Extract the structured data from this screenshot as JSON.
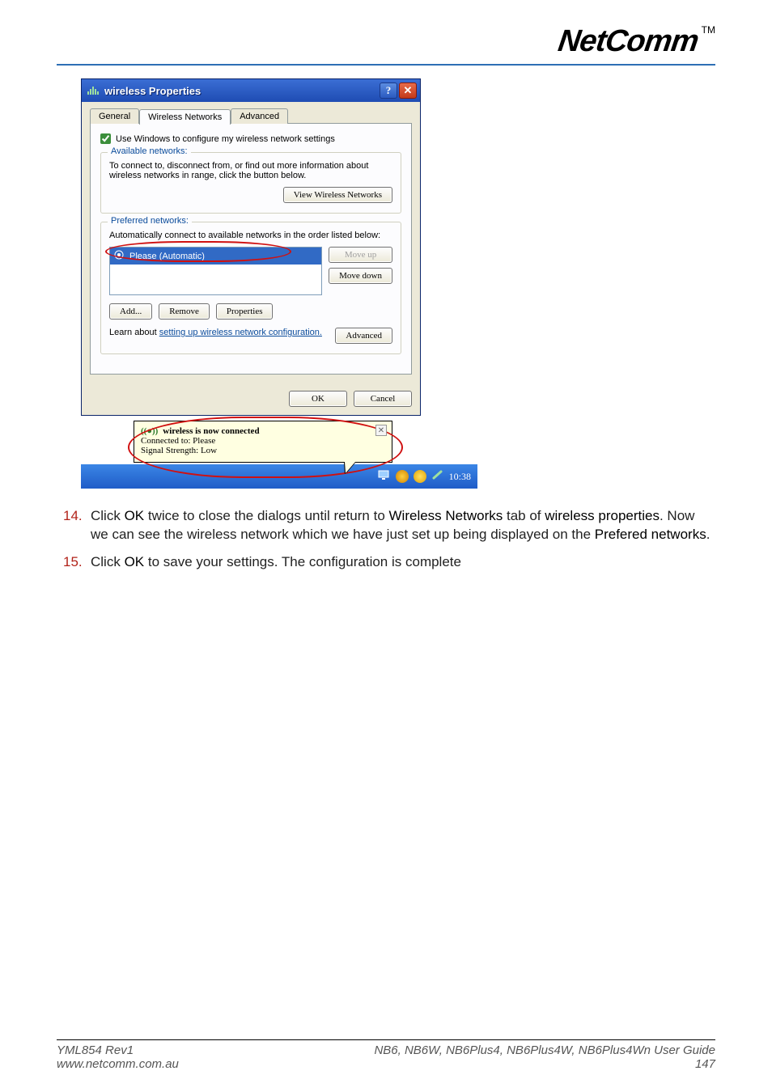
{
  "brand": {
    "name": "NetComm",
    "tm": "TM"
  },
  "dialog": {
    "title": "wireless Properties",
    "tabs": {
      "general": "General",
      "wireless": "Wireless Networks",
      "advanced": "Advanced"
    },
    "use_windows_label": "Use Windows to configure my wireless network settings",
    "available": {
      "legend": "Available networks:",
      "desc": "To connect to, disconnect from, or find out more information about wireless networks in range, click the button below.",
      "view_btn": "View Wireless Networks"
    },
    "preferred": {
      "legend": "Preferred networks:",
      "desc": "Automatically connect to available networks in the order listed below:",
      "item": "Please (Automatic)",
      "move_up": "Move up",
      "move_down": "Move down",
      "add": "Add...",
      "remove": "Remove",
      "properties": "Properties",
      "learn_prefix": "Learn about ",
      "learn_link": "setting up wireless network configuration.",
      "advanced_btn": "Advanced"
    },
    "ok": "OK",
    "cancel": "Cancel"
  },
  "balloon": {
    "title": "wireless is now connected",
    "line1": "Connected to: Please",
    "line2": "Signal Strength: Low"
  },
  "taskbar": {
    "clock": "10:38"
  },
  "steps": {
    "s14_num": "14.",
    "s14_a": "Click ",
    "s14_b": "OK",
    "s14_c": " twice to close the dialogs until return to ",
    "s14_d": "Wireless Networks",
    "s14_e": " tab of ",
    "s14_f": "wireless properties",
    "s14_g": ". Now we can see the wireless network which we have just set up being displayed on the ",
    "s14_h": "Prefered networks",
    "s14_i": ".",
    "s15_num": "15.",
    "s15_a": "Click ",
    "s15_b": "OK",
    "s15_c": " to save your settings. The configuration is complete"
  },
  "footer": {
    "left1": "YML854 Rev1",
    "left2": "www.netcomm.com.au",
    "right1_models": "NB6, NB6W, NB6Plus4, NB6Plus4W, NB6Plus4Wn",
    "right1_suffix": " User Guide",
    "right2": "147"
  }
}
